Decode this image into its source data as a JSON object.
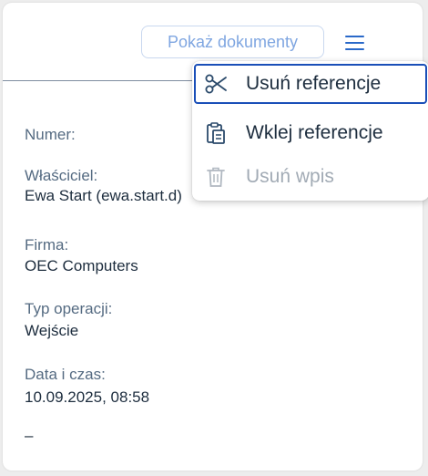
{
  "header": {
    "show_documents_label": "Pokaż dokumenty"
  },
  "fields": [
    {
      "label": "Numer:",
      "value": ""
    },
    {
      "label": "Właściciel:",
      "value": "Ewa Start (ewa.start.d)"
    },
    {
      "label": "Firma:",
      "value": "OEC Computers"
    },
    {
      "label": "Typ operacji:",
      "value": "Wejście"
    },
    {
      "label": "Data i czas:",
      "value": "10.09.2025, 08:58"
    }
  ],
  "trailing_value": "–",
  "menu": {
    "items": [
      {
        "label": "Usuń referencje",
        "icon": "scissors-icon",
        "state": "focused"
      },
      {
        "label": "Wklej referencje",
        "icon": "paste-icon",
        "state": "enabled"
      },
      {
        "label": "Usuń wpis",
        "icon": "trash-icon",
        "state": "disabled"
      }
    ]
  },
  "colors": {
    "accent": "#2a69c9",
    "focus_border": "#1a4fb8",
    "label_text": "#556b82",
    "value_text": "#1d2d3e",
    "disabled_text": "#a2abb5"
  }
}
